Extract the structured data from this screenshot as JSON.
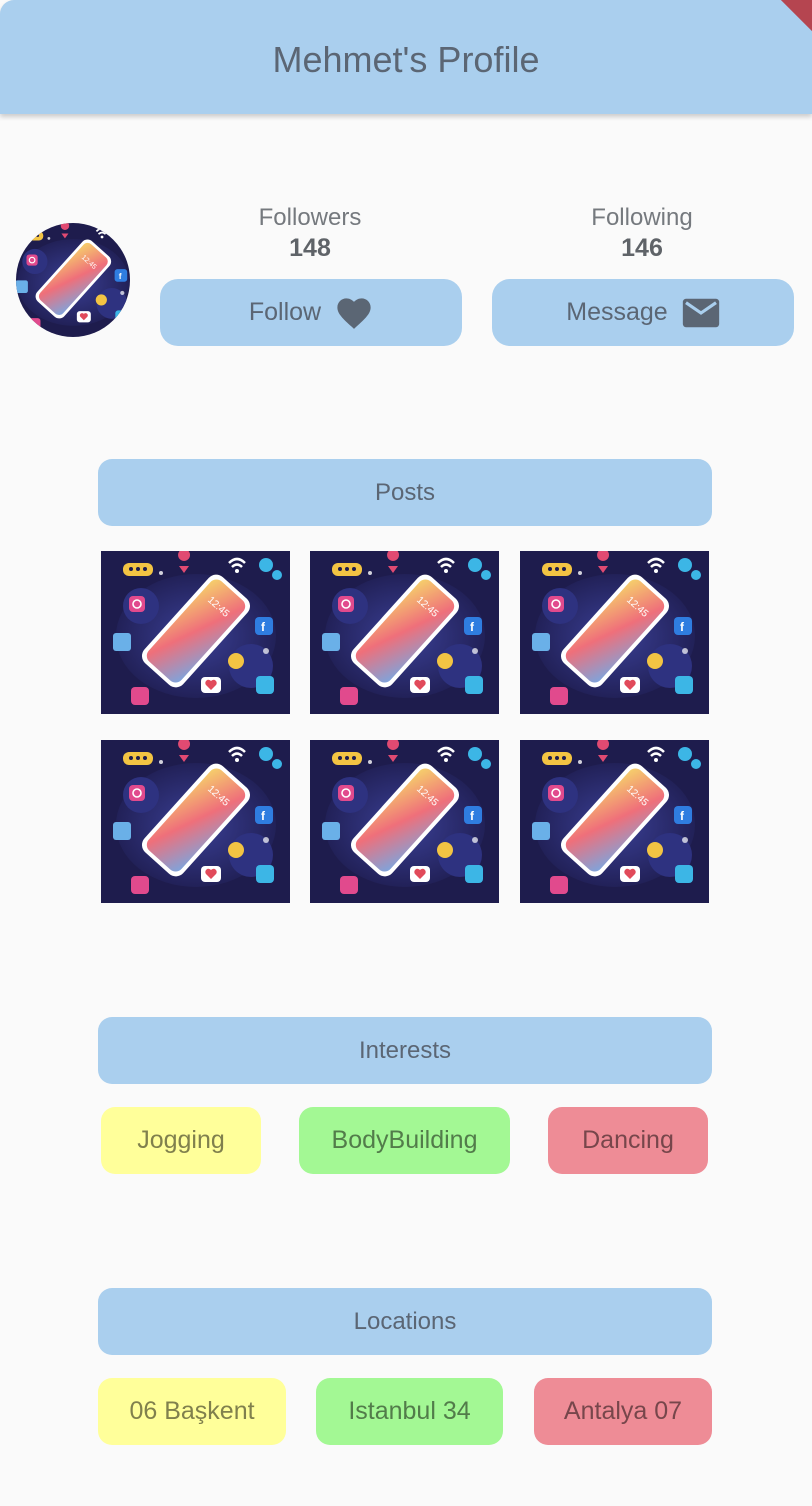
{
  "appbar": {
    "title": "Mehmet's Profile"
  },
  "profile": {
    "avatar_icon": "phone-social-illustration",
    "followers": {
      "label": "Followers",
      "count": "148"
    },
    "following": {
      "label": "Following",
      "count": "146"
    }
  },
  "actions": {
    "follow_label": "Follow",
    "follow_icon": "heart-icon",
    "message_label": "Message",
    "message_icon": "mail-icon"
  },
  "sections": {
    "posts": "Posts",
    "interests": "Interests",
    "locations": "Locations"
  },
  "posts": [
    {
      "image": "phone-social-illustration"
    },
    {
      "image": "phone-social-illustration"
    },
    {
      "image": "phone-social-illustration"
    },
    {
      "image": "phone-social-illustration"
    },
    {
      "image": "phone-social-illustration"
    },
    {
      "image": "phone-social-illustration"
    }
  ],
  "interests": [
    {
      "label": "Jogging",
      "color": "#ffff9a"
    },
    {
      "label": "BodyBuilding",
      "color": "#a3f894"
    },
    {
      "label": "Dancing",
      "color": "#ee8c96"
    }
  ],
  "locations": [
    {
      "label": "06 Başkent",
      "color": "#ffff9a"
    },
    {
      "label": "Istanbul 34",
      "color": "#a3f894"
    },
    {
      "label": "Antalya 07",
      "color": "#ee8c96"
    }
  ],
  "colors": {
    "accent": "#aacfee",
    "text": "#5b6674",
    "background": "#fafafa"
  }
}
